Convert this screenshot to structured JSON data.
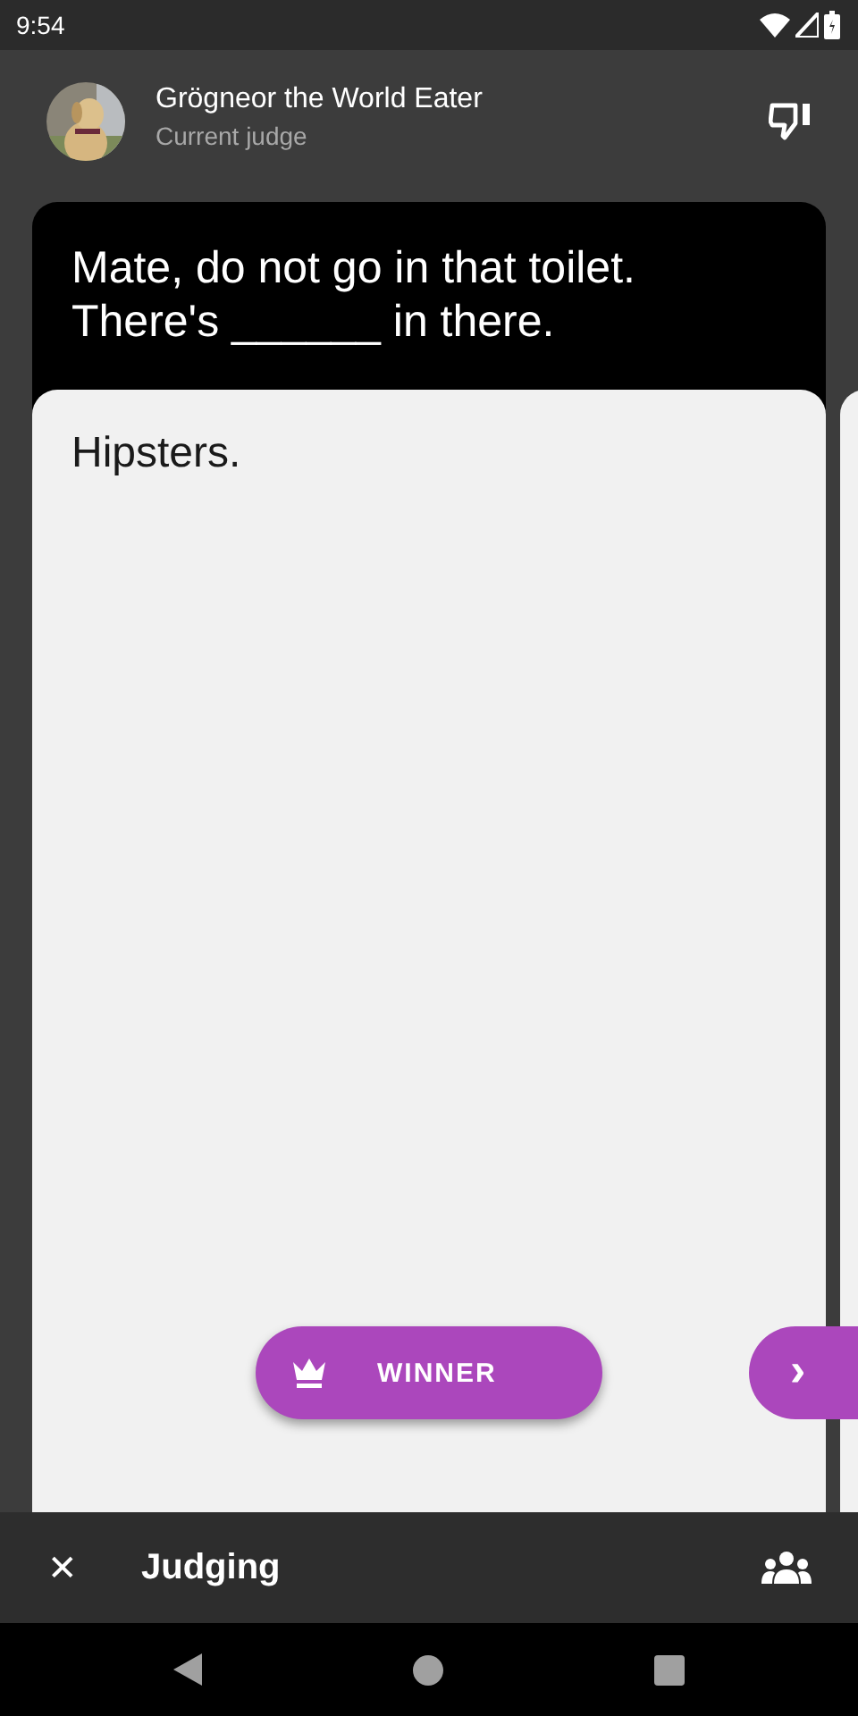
{
  "status_bar": {
    "time": "9:54"
  },
  "judge": {
    "name": "Grögneor the World Eater",
    "role": "Current judge"
  },
  "black_card": {
    "text": "Mate, do not go in that toilet. There's ______ in there."
  },
  "white_card": {
    "text": "Hipsters."
  },
  "winner_button": {
    "label": "WINNER"
  },
  "next_button": {
    "label": "›"
  },
  "bottom_bar": {
    "close": "✕",
    "title": "Judging"
  }
}
